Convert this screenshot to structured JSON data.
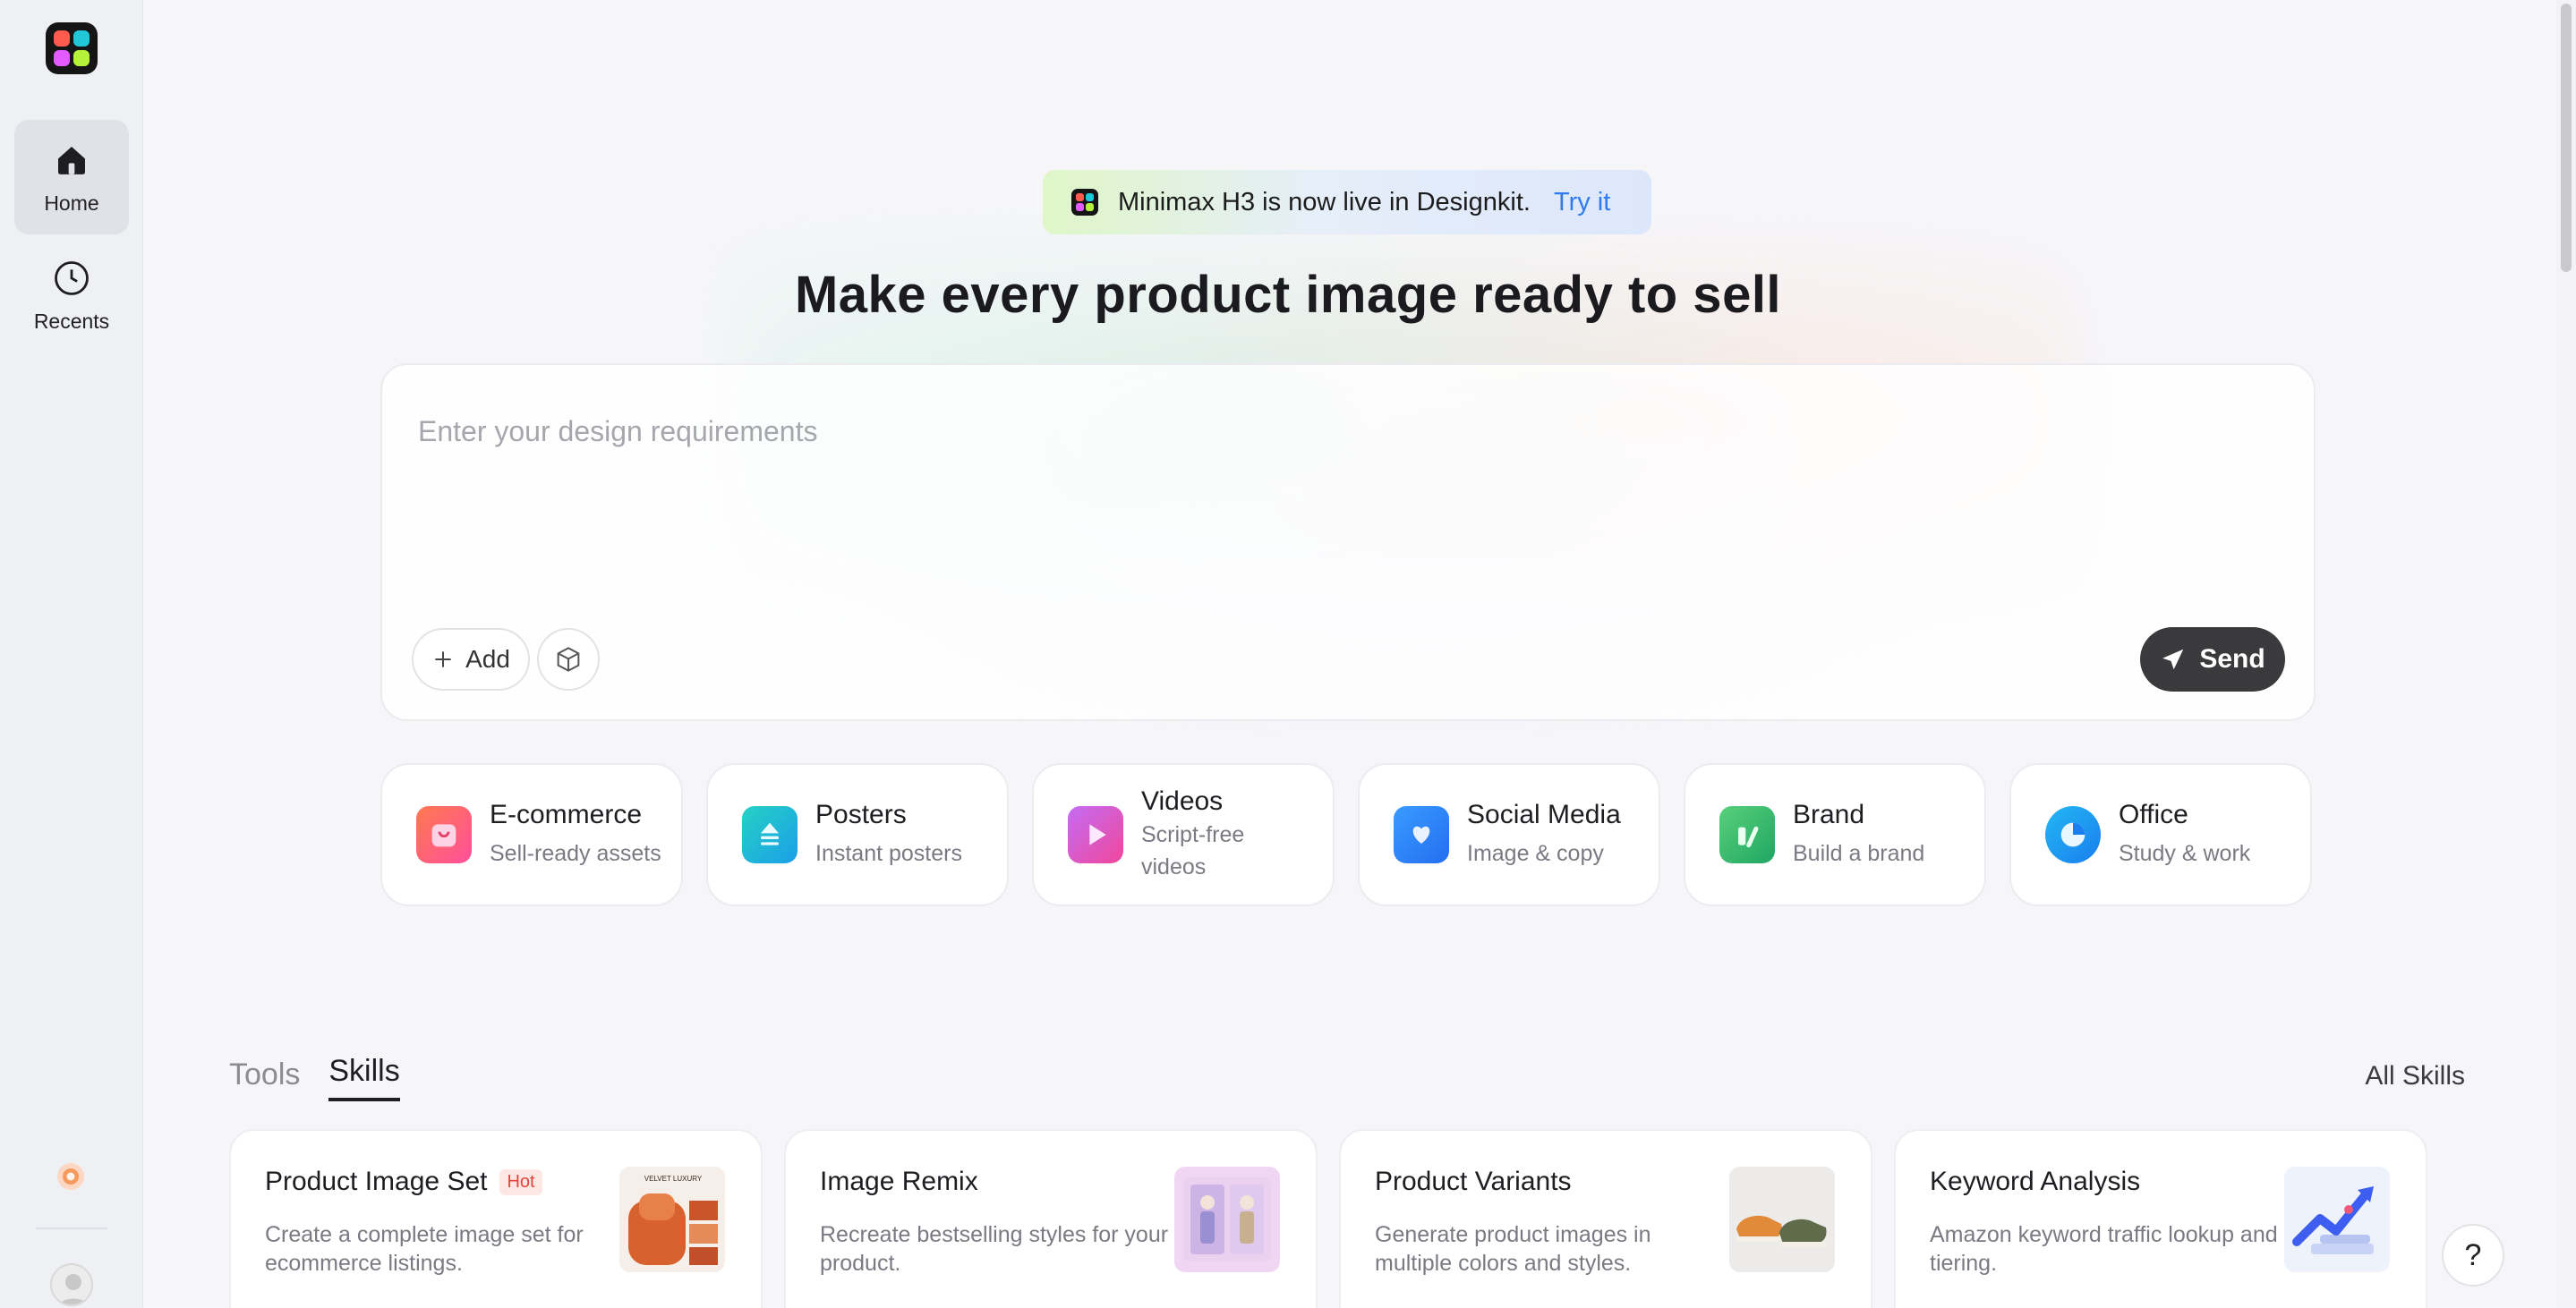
{
  "sidebar": {
    "items": [
      {
        "label": "Home",
        "icon": "home-icon",
        "active": true
      },
      {
        "label": "Recents",
        "icon": "clock-icon",
        "active": false
      }
    ]
  },
  "banner": {
    "text": "Minimax H3 is now live in Designkit.",
    "link": "Try it"
  },
  "headline": "Make every product image ready to sell",
  "prompt": {
    "placeholder": "Enter your design requirements",
    "add_label": "Add",
    "send_label": "Send"
  },
  "categories": [
    {
      "title": "E-commerce",
      "subtitle": "Sell-ready assets",
      "color": "#f0605a"
    },
    {
      "title": "Posters",
      "subtitle": "Instant posters",
      "color": "#1fb8d8"
    },
    {
      "title": "Videos",
      "subtitle": "Script-free videos",
      "color": "#d64be0"
    },
    {
      "title": "Social Media",
      "subtitle": "Image & copy",
      "color": "#2f8cf5"
    },
    {
      "title": "Brand",
      "subtitle": "Build a brand",
      "color": "#36b86a"
    },
    {
      "title": "Office",
      "subtitle": "Study & work",
      "color": "#1a90f0"
    }
  ],
  "tabs": [
    {
      "label": "Tools",
      "active": false
    },
    {
      "label": "Skills",
      "active": true
    }
  ],
  "all_skills": "All Skills",
  "skills": [
    {
      "title": "Product Image Set",
      "badge": "Hot",
      "description": "Create a complete image set for ecommerce listings.",
      "thumb_text": "VELVET LUXURY"
    },
    {
      "title": "Image Remix",
      "badge": "",
      "description": "Recreate bestselling styles for your product."
    },
    {
      "title": "Product Variants",
      "badge": "",
      "description": "Generate product images in multiple colors and styles."
    },
    {
      "title": "Keyword Analysis",
      "badge": "",
      "description": "Amazon keyword traffic lookup and tiering."
    }
  ],
  "help": "?"
}
